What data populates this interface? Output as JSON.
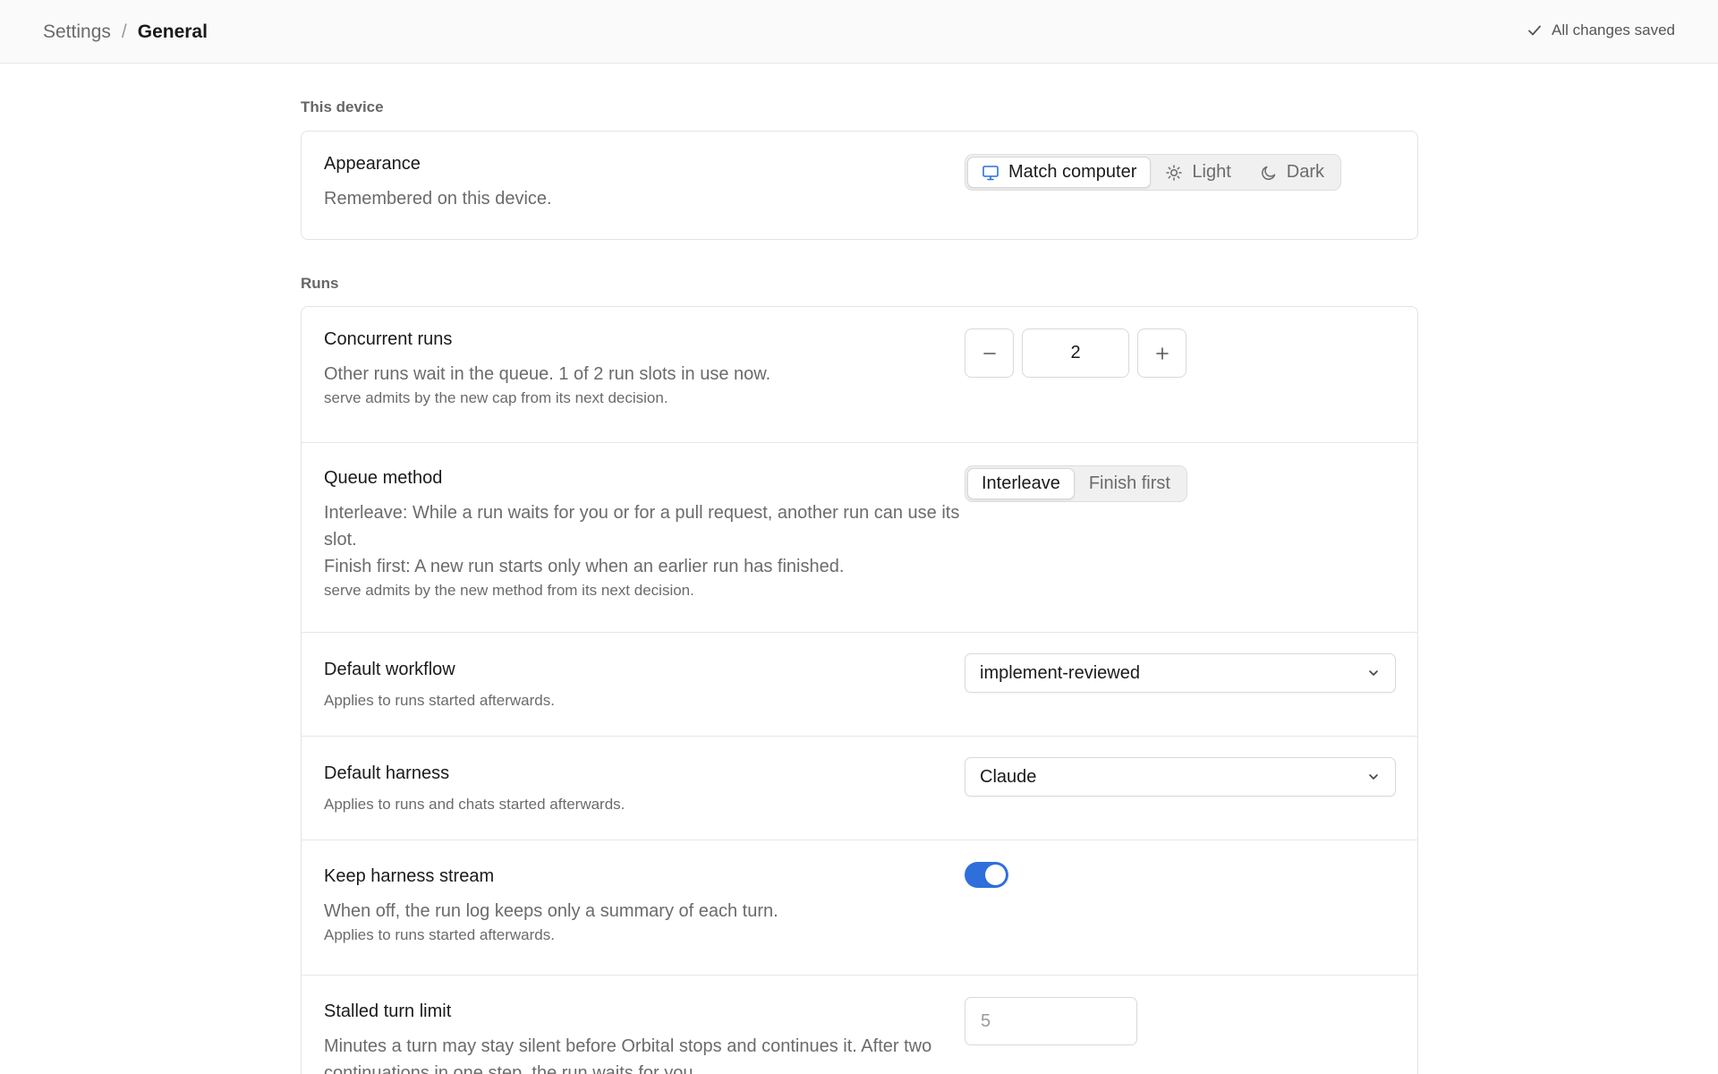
{
  "header": {
    "breadcrumb": {
      "parent": "Settings",
      "separator": "/",
      "current": "General"
    },
    "status": {
      "icon": "check-icon",
      "label": "All changes saved"
    }
  },
  "sections": {
    "device": {
      "label": "This device",
      "appearance": {
        "title": "Appearance",
        "description": "Remembered on this device.",
        "options": [
          {
            "label": "Match computer",
            "icon": "monitor-icon"
          },
          {
            "label": "Light",
            "icon": "sun-icon"
          },
          {
            "label": "Dark",
            "icon": "moon-icon"
          }
        ],
        "selected": "Match computer"
      }
    },
    "runs": {
      "label": "Runs",
      "concurrent": {
        "title": "Concurrent runs",
        "description": "Other runs wait in the queue. 1 of 2 run slots in use now.",
        "note": "serve admits by the new cap from its next decision.",
        "value": "2"
      },
      "queue": {
        "title": "Queue method",
        "description_1": "Interleave: While a run waits for you or for a pull request, another run can use its slot.",
        "description_2": "Finish first: A new run starts only when an earlier run has finished.",
        "note": "serve admits by the new method from its next decision.",
        "options": [
          "Interleave",
          "Finish first"
        ],
        "selected": "Interleave"
      },
      "workflow": {
        "title": "Default workflow",
        "note": "Applies to runs started afterwards.",
        "value": "implement-reviewed"
      },
      "harness": {
        "title": "Default harness",
        "note": "Applies to runs and chats started afterwards.",
        "value": "Claude"
      },
      "stream": {
        "title": "Keep harness stream",
        "description": "When off, the run log keeps only a summary of each turn.",
        "note": "Applies to runs started afterwards.",
        "enabled": true
      },
      "stalled": {
        "title": "Stalled turn limit",
        "description": "Minutes a turn may stay silent before Orbital stops and continues it. After two continuations in one step, the run waits for you.",
        "placeholder": "5"
      }
    }
  },
  "colors": {
    "accent": "#2f6fdb",
    "border": "#e3e3e3",
    "muted_text": "#6b6b6b"
  }
}
